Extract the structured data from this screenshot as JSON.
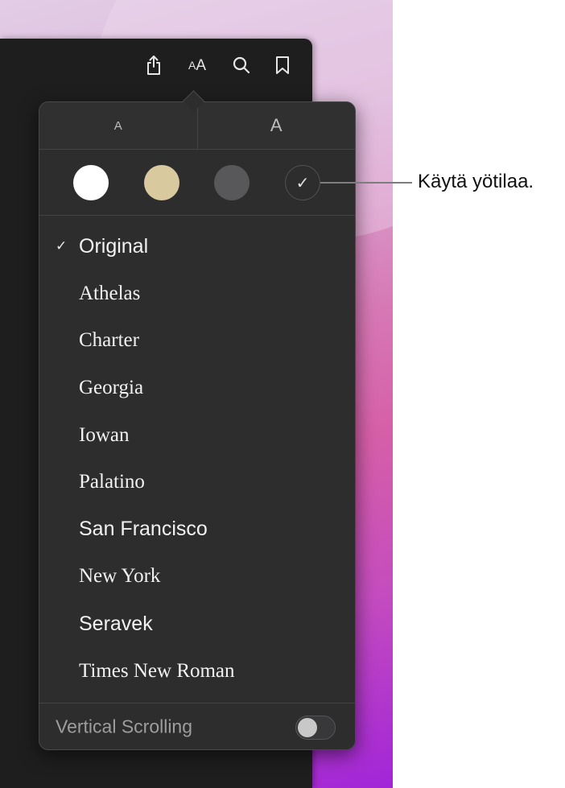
{
  "toolbar": {
    "icons": [
      "share-icon",
      "text-size-icon",
      "search-icon",
      "bookmark-icon"
    ],
    "text_size_small": "A",
    "text_size_large": "A"
  },
  "popover": {
    "size_buttons": {
      "smaller": "A",
      "larger": "A"
    },
    "themes": [
      {
        "name": "white",
        "color": "#ffffff"
      },
      {
        "name": "sepia",
        "color": "#d9c99e"
      },
      {
        "name": "gray",
        "color": "#58585a"
      },
      {
        "name": "night",
        "color": "#2d2d2e",
        "selected": true,
        "mark": "✓"
      }
    ],
    "fonts": [
      {
        "label": "Original",
        "selected": true,
        "check": "✓"
      },
      {
        "label": "Athelas"
      },
      {
        "label": "Charter"
      },
      {
        "label": "Georgia"
      },
      {
        "label": "Iowan"
      },
      {
        "label": "Palatino"
      },
      {
        "label": "San Francisco"
      },
      {
        "label": "New York"
      },
      {
        "label": "Seravek"
      },
      {
        "label": "Times New Roman"
      }
    ],
    "vertical_scrolling": {
      "label": "Vertical Scrolling",
      "on": false
    }
  },
  "callout": {
    "text": "Käytä yötilaa."
  }
}
